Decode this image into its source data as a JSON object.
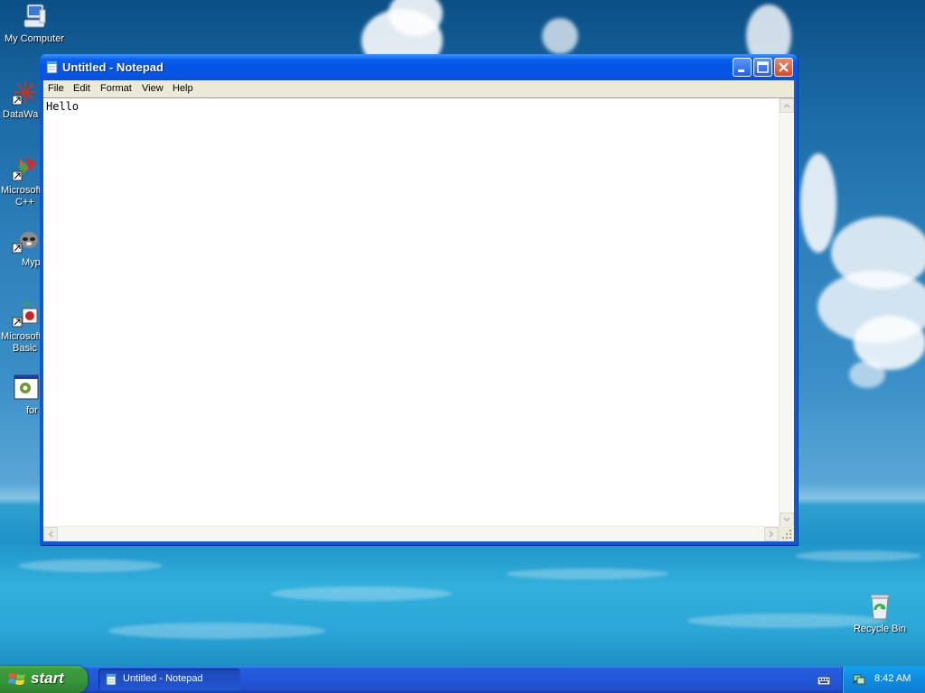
{
  "desktop": {
    "icons": [
      {
        "label": "My Computer",
        "icon": "my-computer-icon"
      },
      {
        "label": "DataWa",
        "icon": "datawarehouse-icon"
      },
      {
        "label": "Microsoft",
        "label2": "C++",
        "icon": "visual-cpp-icon"
      },
      {
        "label": "Myp",
        "icon": "raccoon-shortcut-icon"
      },
      {
        "label": "Microsoft",
        "label2": "Basic",
        "icon": "visual-basic-icon"
      },
      {
        "label": "for",
        "icon": "form-app-icon"
      }
    ],
    "recycle_bin": {
      "label": "Recycle Bin",
      "icon": "recycle-bin-icon"
    }
  },
  "notepad": {
    "title": "Untitled - Notepad",
    "menu": [
      "File",
      "Edit",
      "Format",
      "View",
      "Help"
    ],
    "content": "Hello",
    "buttons": {
      "minimize": "minimize-icon",
      "maximize": "maximize-icon",
      "close": "close-icon"
    }
  },
  "taskbar": {
    "start_label": "start",
    "tasks": [
      {
        "label": "Untitled - Notepad",
        "icon": "notepad-icon",
        "active": true
      }
    ],
    "tray": {
      "language_icon": "keyboard-icon",
      "network_icon": "network-icon",
      "clock": "8:42 AM"
    }
  },
  "colors": {
    "taskbar_blue": "#245edb",
    "start_green": "#3b9d3a",
    "tray_blue": "#0f8ce0",
    "title_blue": "#0454e3"
  }
}
